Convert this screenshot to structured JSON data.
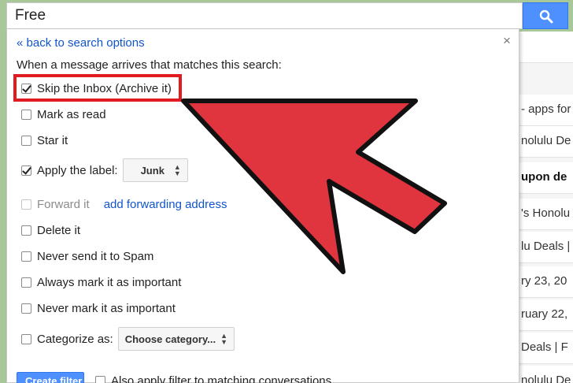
{
  "search": {
    "query": "Free"
  },
  "panel": {
    "back_link": "« back to search options",
    "close": "×",
    "intro": "When a message arrives that matches this search:",
    "options": {
      "skip_inbox": {
        "label": "Skip the Inbox (Archive it)",
        "checked": true
      },
      "mark_read": {
        "label": "Mark as read",
        "checked": false
      },
      "star": {
        "label": "Star it",
        "checked": false
      },
      "apply_label": {
        "label": "Apply the label:",
        "checked": true,
        "value": "Junk"
      },
      "forward": {
        "label": "Forward it",
        "checked": false,
        "link": "add forwarding address"
      },
      "delete": {
        "label": "Delete it",
        "checked": false
      },
      "never_spam": {
        "label": "Never send it to Spam",
        "checked": false
      },
      "always_important": {
        "label": "Always mark it as important",
        "checked": false
      },
      "never_important": {
        "label": "Never mark it as important",
        "checked": false
      },
      "categorize": {
        "label": "Categorize as:",
        "checked": false,
        "value": "Choose category..."
      }
    },
    "create_button": "Create filter",
    "also_apply": "Also apply filter to matching conversations."
  },
  "background_list": [
    {
      "text": "",
      "bold": false
    },
    {
      "text": "- apps for",
      "bold": false
    },
    {
      "text": "nolulu De",
      "bold": false
    },
    {
      "text": "upon de",
      "bold": true
    },
    {
      "text": "'s Honolu",
      "bold": false
    },
    {
      "text": "lu Deals |",
      "bold": false
    },
    {
      "text": "ry 23, 20",
      "bold": false
    },
    {
      "text": "ruary 22,",
      "bold": false
    },
    {
      "text": "Deals | F",
      "bold": false
    },
    {
      "text": "nolulu De",
      "bold": false
    }
  ],
  "colors": {
    "accent_blue": "#4d90fe",
    "link": "#15c",
    "highlight_red": "#e11b22",
    "arrow_red": "#e0343f"
  }
}
